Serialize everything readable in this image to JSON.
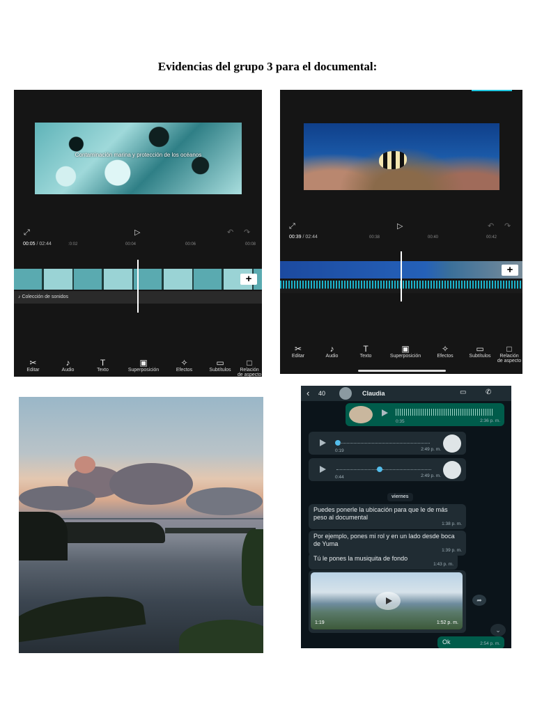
{
  "document": {
    "title": "Evidencias del grupo 3 para el documental:"
  },
  "editor1": {
    "caption": "Contaminación marina y protección de los océanos",
    "timecode_current": "00:05",
    "timecode_total": "/ 02:44",
    "ticks": [
      ":0:02",
      "00:04",
      "00:06",
      "00:08"
    ],
    "sound_row": "Colección de sonidos",
    "tools": [
      "Editar",
      "Audio",
      "Texto",
      "Superposición",
      "Efectos",
      "Subtítulos",
      "Relación de aspecto"
    ]
  },
  "editor2": {
    "timecode_current": "00:39",
    "timecode_total": "/ 02:44",
    "ticks": [
      "00:38",
      "00:40",
      "00:42"
    ],
    "tools": [
      "Editar",
      "Audio",
      "Texto",
      "Superposición",
      "Efectos",
      "Subtítulos",
      "Relación de aspecto"
    ]
  },
  "chat": {
    "back_count": "40",
    "contact": "Claudia",
    "voice1": {
      "duration": "0:35",
      "time": "2:36 p. m."
    },
    "voice2": {
      "duration": "0:19",
      "time": "2:49 p. m."
    },
    "voice3": {
      "duration": "0:44",
      "time": "2:49 p. m."
    },
    "day": "viernes",
    "messages": [
      {
        "text": "Puedes ponerle la ubicación para que le de más peso al documental",
        "time": "1:38 p. m."
      },
      {
        "text": "Por ejemplo, pones mi rol y en un lado desde boca de Yuma",
        "time": "1:39 p. m."
      },
      {
        "text": "Tú le pones la musiquita de fondo",
        "time": "1:43 p. m."
      }
    ],
    "video": {
      "duration": "1:19",
      "time": "1:52 p. m."
    },
    "reply": {
      "text": "Ok",
      "time": "2:54 p. m."
    }
  },
  "icons": [
    "scissors-icon",
    "note-icon",
    "text-icon",
    "overlay-icon",
    "effects-icon",
    "subtitles-icon",
    "aspect-icon",
    "play-icon",
    "undo-icon",
    "redo-icon",
    "fullscreen-icon",
    "video-call-icon",
    "phone-icon",
    "forward-icon",
    "scroll-down-icon"
  ]
}
